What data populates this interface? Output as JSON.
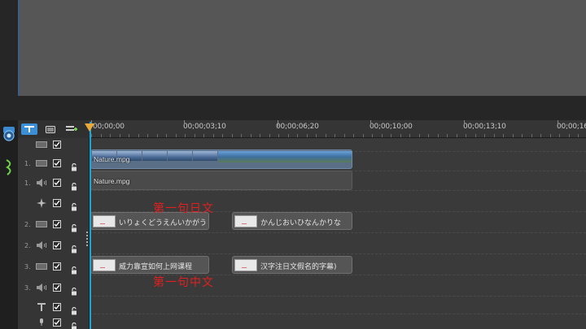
{
  "ruler": {
    "ticks": [
      "00;00;00",
      "00;00;03;10",
      "00;00;06;20",
      "00;00;10;00",
      "00;00;13;10",
      "00;00;16"
    ]
  },
  "tracks": [
    {
      "num": "",
      "type": "video-track-icon"
    },
    {
      "num": "1.",
      "type": "video-track-icon"
    },
    {
      "num": "1.",
      "type": "audio-track-icon"
    },
    {
      "num": "",
      "type": "effect-track-icon"
    },
    {
      "num": "2.",
      "type": "video-track-icon"
    },
    {
      "num": "2.",
      "type": "audio-track-icon"
    },
    {
      "num": "3.",
      "type": "video-track-icon"
    },
    {
      "num": "3.",
      "type": "audio-track-icon"
    },
    {
      "num": "",
      "type": "title-track-icon"
    },
    {
      "num": "",
      "type": "voice-track-icon"
    }
  ],
  "clips": {
    "video_label": "Nature.mpg",
    "audio_label": "Nature.mpg"
  },
  "subtitles": {
    "row2_a": "いりょくどうえんいかがう",
    "row2_b": "かんじおいひなんかりな",
    "row3_a": "威力靠宣如何上网课程",
    "row3_b": "汉字注日文假名的字幕)"
  },
  "annotations": {
    "japanese_label": "第一句日文",
    "chinese_label": "第一句中文"
  },
  "colors": {
    "annotation": "#e02020",
    "playhead": "#1aa6d6",
    "active_button": "#3a8fd6"
  }
}
